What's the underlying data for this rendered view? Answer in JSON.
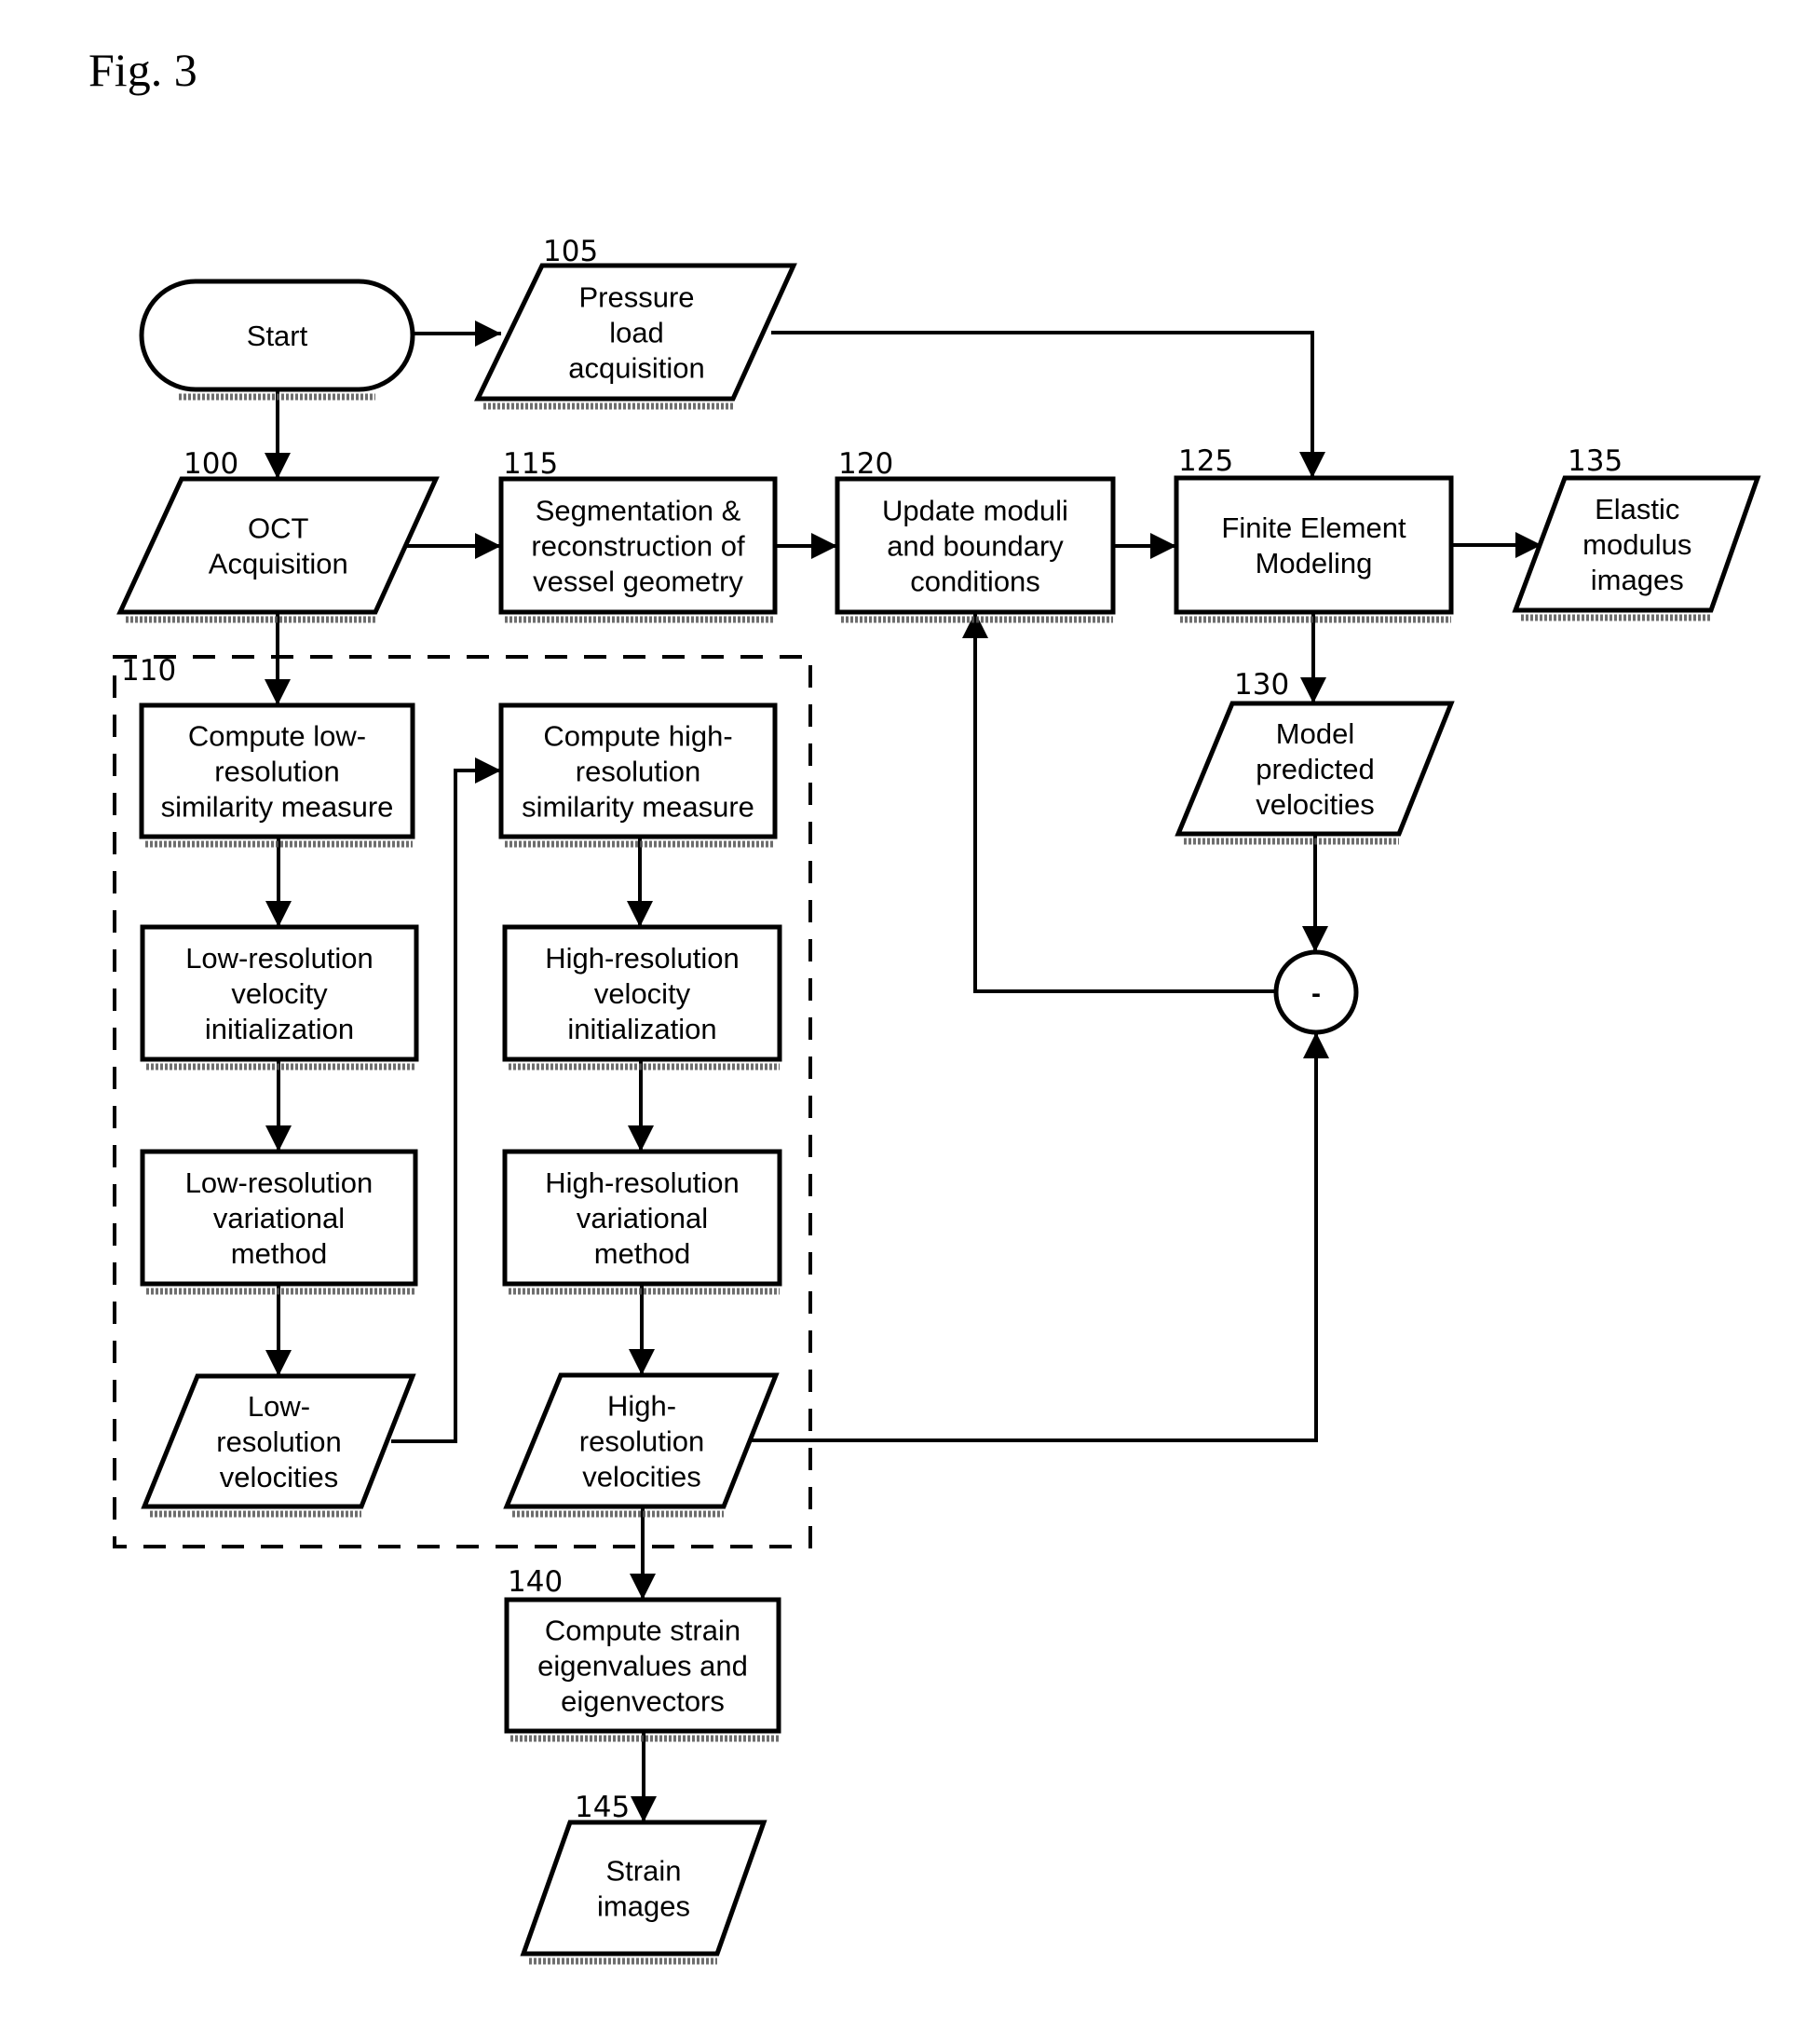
{
  "figure": {
    "title": "Fig. 3"
  },
  "nodes": {
    "start": {
      "ref": "",
      "lines": [
        "Start"
      ]
    },
    "pressure": {
      "ref": "105",
      "lines": [
        "Pressure",
        "load",
        "acquisition"
      ]
    },
    "oct": {
      "ref": "100",
      "lines": [
        "OCT",
        "Acquisition"
      ]
    },
    "segmentation": {
      "ref": "115",
      "lines": [
        "Segmentation &",
        "reconstruction of",
        "vessel geometry"
      ]
    },
    "update": {
      "ref": "120",
      "lines": [
        "Update moduli",
        "and boundary",
        "conditions"
      ]
    },
    "fem": {
      "ref": "125",
      "lines": [
        "Finite Element",
        "Modeling"
      ]
    },
    "elastic": {
      "ref": "135",
      "lines": [
        "Elastic",
        "modulus",
        "images"
      ]
    },
    "model_pred": {
      "ref": "130",
      "lines": [
        "Model",
        "predicted",
        "velocities"
      ]
    },
    "subtract": {
      "ref": "",
      "lines": [
        "-"
      ]
    },
    "group": {
      "ref": "110"
    },
    "low_sim": {
      "ref": "",
      "lines": [
        "Compute low-",
        "resolution",
        "similarity measure"
      ]
    },
    "high_sim": {
      "ref": "",
      "lines": [
        "Compute high-",
        "resolution",
        "similarity measure"
      ]
    },
    "low_init": {
      "ref": "",
      "lines": [
        "Low-resolution",
        "velocity",
        "initialization"
      ]
    },
    "high_init": {
      "ref": "",
      "lines": [
        "High-resolution",
        "velocity",
        "initialization"
      ]
    },
    "low_var": {
      "ref": "",
      "lines": [
        "Low-resolution",
        "variational",
        "method"
      ]
    },
    "high_var": {
      "ref": "",
      "lines": [
        "High-resolution",
        "variational",
        "method"
      ]
    },
    "low_vel": {
      "ref": "",
      "lines": [
        "Low-",
        "resolution",
        "velocities"
      ]
    },
    "high_vel": {
      "ref": "",
      "lines": [
        "High-",
        "resolution",
        "velocities"
      ]
    },
    "strain_comp": {
      "ref": "140",
      "lines": [
        "Compute strain",
        "eigenvalues and",
        "eigenvectors"
      ]
    },
    "strain_img": {
      "ref": "145",
      "lines": [
        "Strain",
        "images"
      ]
    }
  },
  "edges": [
    {
      "from": "start",
      "to": "pressure"
    },
    {
      "from": "start",
      "to": "oct"
    },
    {
      "from": "pressure",
      "to": "fem"
    },
    {
      "from": "oct",
      "to": "segmentation"
    },
    {
      "from": "segmentation",
      "to": "update"
    },
    {
      "from": "update",
      "to": "fem"
    },
    {
      "from": "fem",
      "to": "elastic"
    },
    {
      "from": "fem",
      "to": "model_pred"
    },
    {
      "from": "model_pred",
      "to": "subtract"
    },
    {
      "from": "subtract",
      "to": "update"
    },
    {
      "from": "oct",
      "to": "low_sim"
    },
    {
      "from": "low_sim",
      "to": "low_init"
    },
    {
      "from": "low_init",
      "to": "low_var"
    },
    {
      "from": "low_var",
      "to": "low_vel"
    },
    {
      "from": "low_vel",
      "to": "high_sim"
    },
    {
      "from": "high_sim",
      "to": "high_init"
    },
    {
      "from": "high_init",
      "to": "high_var"
    },
    {
      "from": "high_var",
      "to": "high_vel"
    },
    {
      "from": "high_vel",
      "to": "subtract"
    },
    {
      "from": "high_vel",
      "to": "strain_comp"
    },
    {
      "from": "strain_comp",
      "to": "strain_img"
    }
  ]
}
